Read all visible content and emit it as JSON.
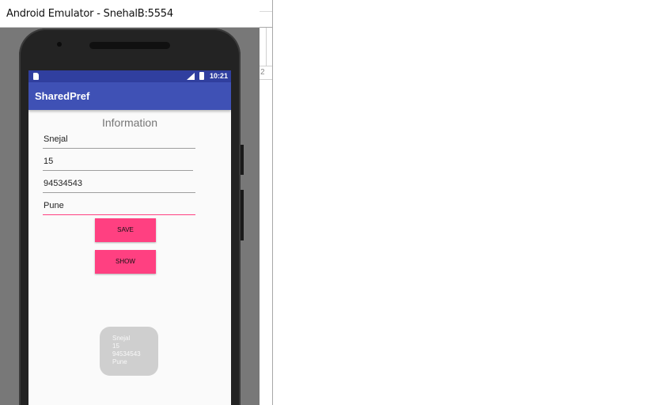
{
  "window": {
    "title": "Android Emulator - SnehalB:5554"
  },
  "status_bar": {
    "time": "10:21"
  },
  "app_bar": {
    "title": "SharedPref"
  },
  "form": {
    "heading": "Information",
    "fields": [
      {
        "value": "Snejal"
      },
      {
        "value": "15"
      },
      {
        "value": "94534543"
      },
      {
        "value": "Pune"
      }
    ],
    "save_label": "SAVE",
    "show_label": "SHOW"
  },
  "toast": {
    "lines": [
      "Snejal",
      "15",
      "94534543",
      "Pune"
    ]
  },
  "ide": {
    "fragment_text": "2"
  },
  "colors": {
    "status_bar": "#303f9f",
    "app_bar": "#3f51b5",
    "accent": "#ff4081",
    "toast_bg": "#cfcfcf"
  },
  "icons": [
    "sim-card-icon",
    "signal-icon",
    "battery-icon",
    "camera-icon",
    "speaker-grille"
  ]
}
